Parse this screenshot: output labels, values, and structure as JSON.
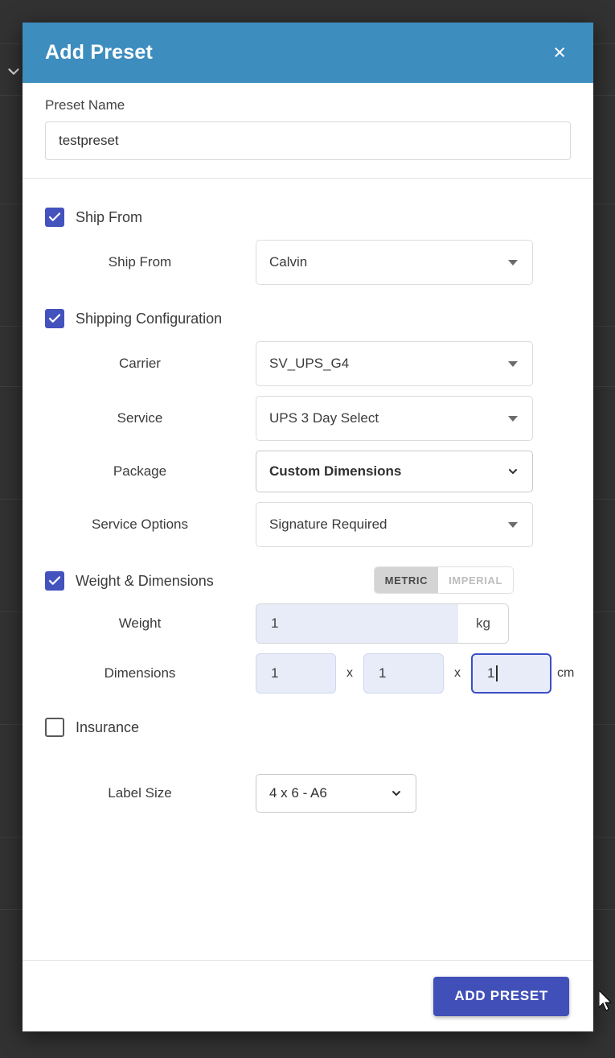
{
  "background": {
    "overlay_color": "#323232",
    "chevron_icon": "chevron-down-icon"
  },
  "modal": {
    "header": {
      "title": "Add Preset",
      "close_label": "×",
      "bg_color": "#3d8dbf"
    },
    "preset_name": {
      "label": "Preset Name",
      "value": "testpreset",
      "placeholder": "Preset Name"
    },
    "sections": {
      "ship_from": {
        "checkbox_label": "Ship From",
        "checked": true,
        "field_label": "Ship From",
        "value": "Calvin"
      },
      "shipping_configuration": {
        "checkbox_label": "Shipping Configuration",
        "checked": true,
        "carrier": {
          "label": "Carrier",
          "value": "SV_UPS_G4"
        },
        "service": {
          "label": "Service",
          "value": "UPS 3 Day Select"
        },
        "package": {
          "label": "Package",
          "value": "Custom Dimensions"
        },
        "service_options": {
          "label": "Service Options",
          "value": "Signature Required"
        }
      },
      "weight_dimensions": {
        "checkbox_label": "Weight & Dimensions",
        "checked": true,
        "units": {
          "metric": "METRIC",
          "imperial": "IMPERIAL",
          "selected": "METRIC"
        },
        "weight": {
          "label": "Weight",
          "value": "1",
          "unit": "kg"
        },
        "dimensions": {
          "label": "Dimensions",
          "length": "1",
          "width": "1",
          "height": "1",
          "separator": "x",
          "unit": "cm",
          "focused_field": "height"
        }
      },
      "insurance": {
        "checkbox_label": "Insurance",
        "checked": false
      },
      "label_size": {
        "label": "Label Size",
        "value": "4 x 6 - A6"
      }
    },
    "footer": {
      "submit_label": "ADD PRESET",
      "submit_color": "#4150b8"
    }
  },
  "theme": {
    "header_blue": "#3d8dbf",
    "checkbox_indigo": "#4352bc",
    "primary_indigo": "#4150b8",
    "input_fill": "#e8ecf9",
    "focus_border": "#3b4fc4"
  }
}
